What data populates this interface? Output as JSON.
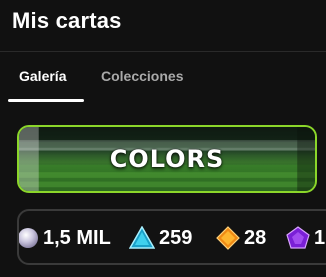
{
  "header": {
    "title": "Mis cartas"
  },
  "tabs": [
    {
      "label": "Galería",
      "active": true
    },
    {
      "label": "Colecciones",
      "active": false
    }
  ],
  "banner": {
    "text": "COLORS",
    "border_color": "#8bd62a"
  },
  "currencies": [
    {
      "icon": "silver-orb-icon",
      "value": "1,5 MIL"
    },
    {
      "icon": "blue-triangle-gem-icon",
      "value": "259"
    },
    {
      "icon": "orange-diamond-gem-icon",
      "value": "28"
    },
    {
      "icon": "purple-pentagon-gem-icon",
      "value": "1"
    }
  ]
}
